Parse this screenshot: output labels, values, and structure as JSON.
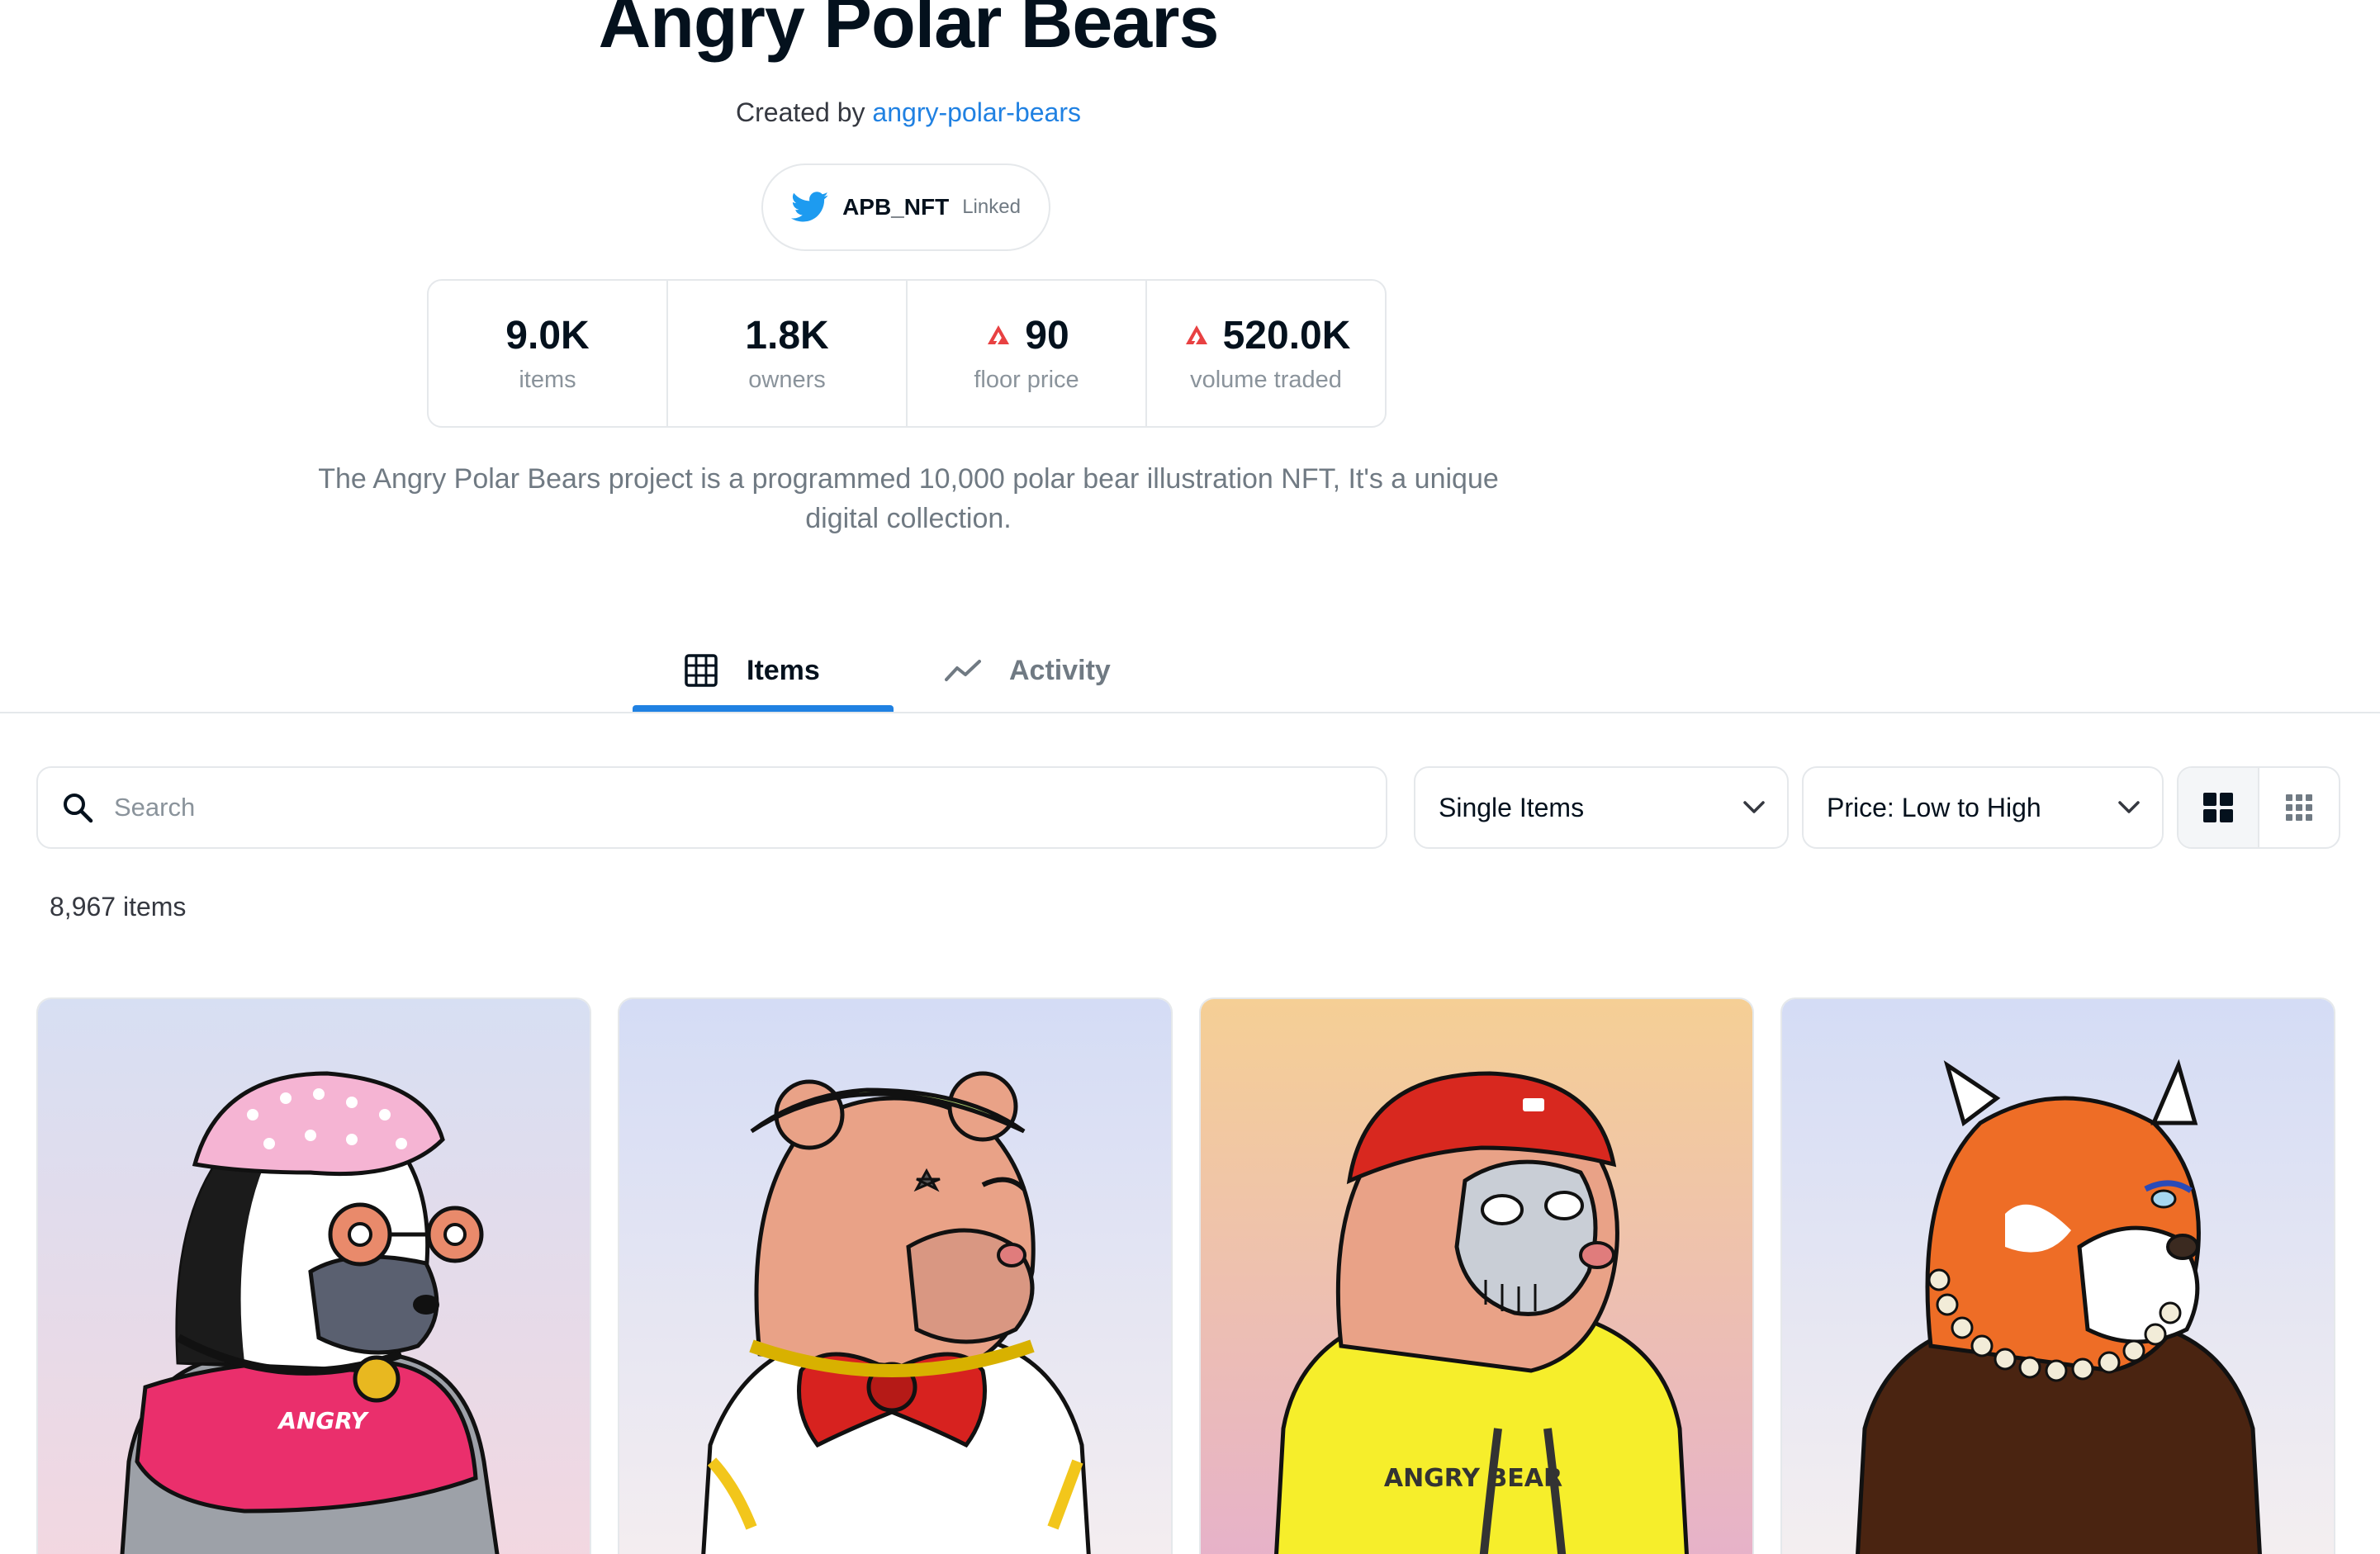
{
  "collection": {
    "title": "Angry Polar Bears",
    "created_by_prefix": "Created by",
    "creator": "angry-polar-bears",
    "twitter_handle": "APB_NFT",
    "twitter_status": "Linked",
    "description": "The Angry Polar Bears project is a programmed 10,000 polar bear illustration NFT, It's a unique digital collection."
  },
  "stats": [
    {
      "value": "9.0K",
      "label": "items",
      "icon": null
    },
    {
      "value": "1.8K",
      "label": "owners",
      "icon": null
    },
    {
      "value": "90",
      "label": "floor price",
      "icon": "avax-coin-icon"
    },
    {
      "value": "520.0K",
      "label": "volume traded",
      "icon": "avax-coin-icon"
    }
  ],
  "tabs": [
    {
      "label": "Items",
      "icon": "grid-icon",
      "active": true
    },
    {
      "label": "Activity",
      "icon": "trending-line-icon",
      "active": false
    }
  ],
  "filters": {
    "search_placeholder": "Search",
    "type_selected": "Single Items",
    "sort_selected": "Price: Low to High",
    "view_modes": [
      "large-grid-icon",
      "small-grid-icon"
    ]
  },
  "item_count": "8,967 items",
  "cards": [
    {
      "background": [
        "#d7dff3",
        "#f3d7e0"
      ],
      "bear": "panda",
      "shirt_text": "ANGRY"
    },
    {
      "background": [
        "#d4dcf5",
        "#f5eef0"
      ],
      "bear": "brown-bowtie",
      "shirt_text": ""
    },
    {
      "background": [
        "#f5cf95",
        "#e6b1cb"
      ],
      "bear": "skull-mask-hoodie",
      "shirt_text": "ANGRY BEAR"
    },
    {
      "background": [
        "#d4dcf5",
        "#f5eff0"
      ],
      "bear": "red-panda",
      "shirt_text": ""
    }
  ],
  "colors": {
    "accent": "#2081e2",
    "avax": "#e84142",
    "border": "#e5e8eb",
    "muted": "#707a83"
  }
}
